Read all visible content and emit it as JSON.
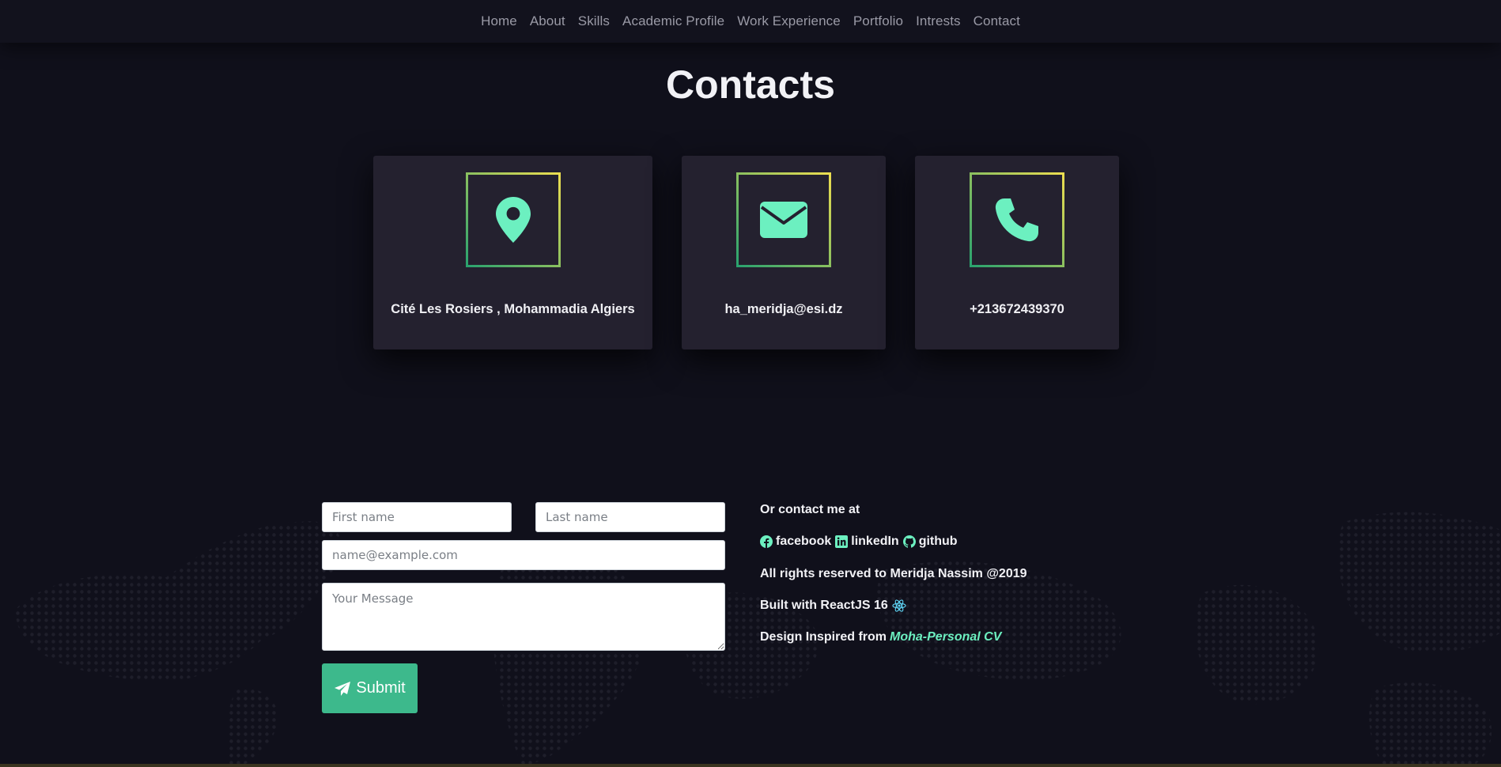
{
  "nav": {
    "items": [
      "Home",
      "About",
      "Skills",
      "Academic Profile",
      "Work Experience",
      "Portfolio",
      "Intrests",
      "Contact"
    ]
  },
  "page": {
    "title": "Contacts"
  },
  "cards": {
    "address": {
      "icon": "map-marker-icon",
      "text": "Cité Les Rosiers , Mohammadia Algiers"
    },
    "email": {
      "icon": "envelope-icon",
      "text": "ha_meridja@esi.dz"
    },
    "phone": {
      "icon": "phone-icon",
      "text": "+213672439370"
    }
  },
  "form": {
    "first_name_placeholder": "First name",
    "last_name_placeholder": "Last name",
    "email_placeholder": "name@example.com",
    "message_placeholder": "Your Message",
    "submit_label": "Submit",
    "submit_icon": "paper-plane-icon"
  },
  "side": {
    "heading": "Or contact me at",
    "social": [
      {
        "label": "facebook",
        "icon": "facebook-icon"
      },
      {
        "label": "linkedIn",
        "icon": "linkedin-icon"
      },
      {
        "label": "github",
        "icon": "github-icon"
      }
    ],
    "rights": "All rights reserved to Meridja Nassim @2019",
    "built_with": "Built with ReactJS 16",
    "built_icon": "react-icon",
    "design_prefix": "Design Inspired from",
    "design_link": "Moha-Personal CV"
  },
  "colors": {
    "background": "#10101b",
    "navbar": "#12121d",
    "card": "#24212f",
    "accent_mint": "#6cf0c0",
    "accent_green": "#3db98c",
    "gradient_start": "#27a26f",
    "gradient_end": "#eede50",
    "react_blue": "#61dafb"
  }
}
